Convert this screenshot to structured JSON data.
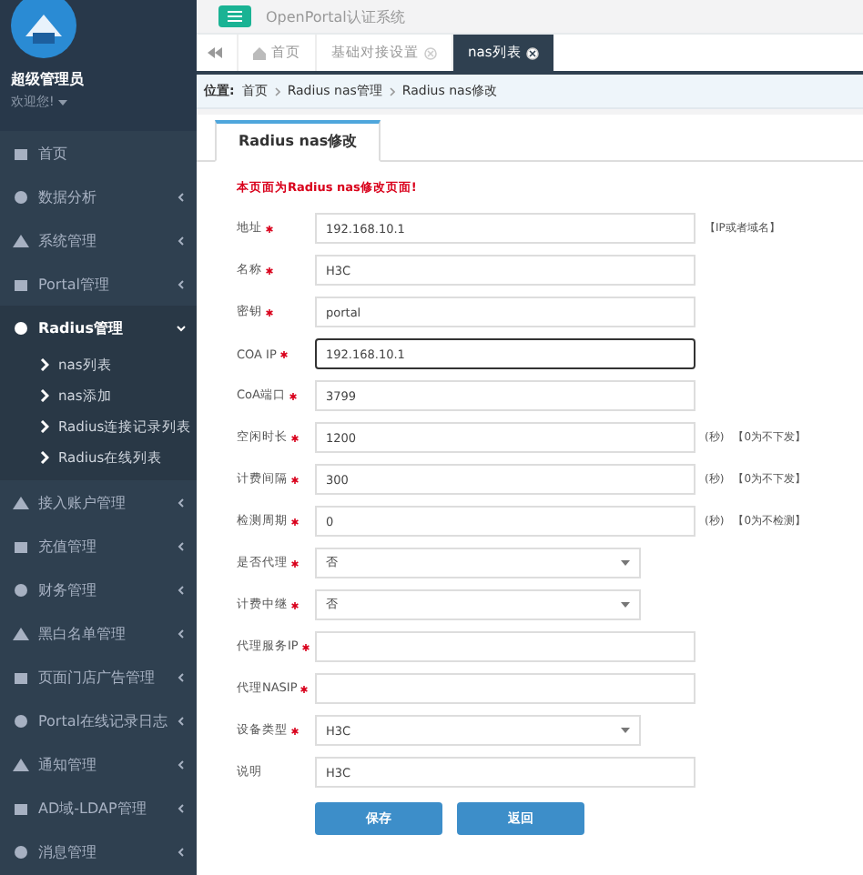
{
  "header": {
    "title": "OpenPortal认证系统"
  },
  "sidebar": {
    "user": "超级管理员",
    "welcome": "欢迎您!",
    "items": [
      {
        "label": "首页",
        "expanded": false,
        "has_children": false
      },
      {
        "label": "数据分析",
        "expanded": false,
        "has_children": true
      },
      {
        "label": "系统管理",
        "expanded": false,
        "has_children": true
      },
      {
        "label": "Portal管理",
        "expanded": false,
        "has_children": true
      },
      {
        "label": "Radius管理",
        "expanded": true,
        "has_children": true,
        "children": [
          {
            "label": "nas列表"
          },
          {
            "label": "nas添加"
          },
          {
            "label": "Radius连接记录列表"
          },
          {
            "label": "Radius在线列表"
          }
        ]
      },
      {
        "label": "接入账户管理",
        "expanded": false,
        "has_children": true
      },
      {
        "label": "充值管理",
        "expanded": false,
        "has_children": true
      },
      {
        "label": "财务管理",
        "expanded": false,
        "has_children": true
      },
      {
        "label": "黑白名单管理",
        "expanded": false,
        "has_children": true
      },
      {
        "label": "页面门店广告管理",
        "expanded": false,
        "has_children": true
      },
      {
        "label": "Portal在线记录日志",
        "expanded": false,
        "has_children": true
      },
      {
        "label": "通知管理",
        "expanded": false,
        "has_children": true
      },
      {
        "label": "AD域-LDAP管理",
        "expanded": false,
        "has_children": true
      },
      {
        "label": "消息管理",
        "expanded": false,
        "has_children": true
      }
    ]
  },
  "tabs": [
    {
      "label": "首页",
      "selected": false,
      "closable": false
    },
    {
      "label": "基础对接设置",
      "selected": false,
      "closable": true
    },
    {
      "label": "nas列表",
      "selected": true,
      "closable": true
    }
  ],
  "breadcrumb": {
    "prefix": "位置:",
    "items": [
      "首页",
      "Radius nas管理",
      "Radius nas修改"
    ]
  },
  "panel": {
    "tab": "Radius nas修改",
    "notice": "本页面为Radius nas修改页面!"
  },
  "fields": [
    {
      "kind": "text",
      "label": "地址",
      "required": true,
      "value": "192.168.10.1",
      "focused": false,
      "hints": [
        "【IP或者域名】"
      ]
    },
    {
      "kind": "text",
      "label": "名称",
      "required": true,
      "value": "H3C",
      "focused": false
    },
    {
      "kind": "text",
      "label": "密钥",
      "required": true,
      "value": "portal",
      "focused": false
    },
    {
      "kind": "text",
      "label": "COA IP",
      "required": true,
      "value": "192.168.10.1",
      "focused": true
    },
    {
      "kind": "text",
      "label": "CoA端口",
      "required": true,
      "value": "3799",
      "focused": false
    },
    {
      "kind": "text",
      "label": "空闲时长",
      "required": true,
      "value": "1200",
      "focused": false,
      "hints": [
        "(秒)",
        "【0为不下发】"
      ]
    },
    {
      "kind": "text",
      "label": "计费间隔",
      "required": true,
      "value": "300",
      "focused": false,
      "hints": [
        "(秒)",
        "【0为不下发】"
      ]
    },
    {
      "kind": "text",
      "label": "检测周期",
      "required": true,
      "value": "0",
      "focused": false,
      "hints": [
        "(秒)",
        "【0为不检测】"
      ]
    },
    {
      "kind": "select",
      "label": "是否代理",
      "required": true,
      "value": "否",
      "focused": false
    },
    {
      "kind": "select",
      "label": "计费中继",
      "required": true,
      "value": "否",
      "focused": false
    },
    {
      "kind": "text",
      "label": "代理服务IP",
      "required": true,
      "focused": false
    },
    {
      "kind": "text",
      "label": "代理NASIP",
      "required": true,
      "focused": false
    },
    {
      "kind": "select",
      "label": "设备类型",
      "required": true,
      "value": "H3C",
      "focused": false
    },
    {
      "kind": "text",
      "label": "说明",
      "required": false,
      "value": "H3C",
      "focused": false
    }
  ],
  "buttons": [
    "保存",
    "返回"
  ]
}
